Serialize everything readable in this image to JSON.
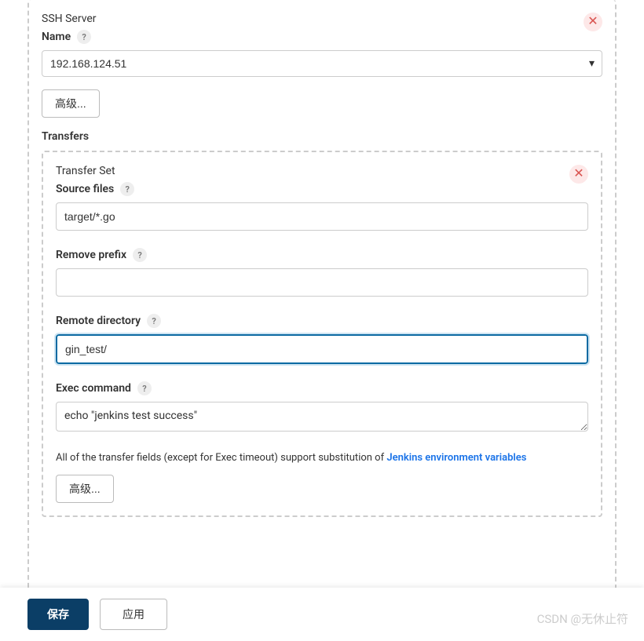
{
  "sshServer": {
    "header": "SSH Server",
    "nameLabel": "Name",
    "nameValue": "192.168.124.51",
    "advancedLabel": "高级..."
  },
  "transfers": {
    "title": "Transfers",
    "setHeader": "Transfer Set",
    "sourceFiles": {
      "label": "Source files",
      "value": "target/*.go"
    },
    "removePrefix": {
      "label": "Remove prefix",
      "value": ""
    },
    "remoteDirectory": {
      "label": "Remote directory",
      "value": "gin_test/"
    },
    "execCommand": {
      "label": "Exec command",
      "value": "echo \"jenkins test success\""
    },
    "hintPrefix": "All of the transfer fields (except for Exec timeout) support substitution of ",
    "hintLink": "Jenkins environment variables",
    "advancedLabel": "高级..."
  },
  "footer": {
    "save": "保存",
    "apply": "应用"
  },
  "icons": {
    "help": "?",
    "remove": "✕",
    "dropdown": "▾"
  },
  "watermark": "CSDN @无休止符"
}
